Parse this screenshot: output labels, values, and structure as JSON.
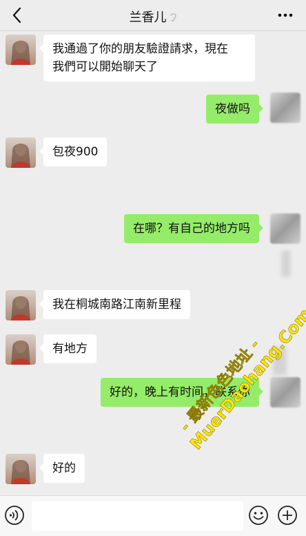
{
  "header": {
    "title": "兰香儿",
    "back_icon": "chevron-left-icon",
    "more_icon": "more-dots-icon",
    "ear_icon": "ear-mode-icon"
  },
  "messages": [
    {
      "side": "left",
      "text_lines": [
        "我通過了你的朋友驗證請求，現在",
        "我們可以開始聊天了"
      ]
    },
    {
      "side": "right",
      "text": "夜做吗"
    },
    {
      "side": "left",
      "text": "包夜900"
    },
    {
      "side": "right",
      "text": "在哪？有自己的地方吗"
    },
    {
      "side": "left",
      "text": "我在桐城南路江南新里程"
    },
    {
      "side": "left",
      "text": "有地方"
    },
    {
      "side": "right",
      "text": "好的，晚上有时间，联系你"
    },
    {
      "side": "left",
      "text": "好的"
    }
  ],
  "input_bar": {
    "voice_icon": "voice-icon",
    "emoji_icon": "emoji-icon",
    "plus_icon": "plus-icon",
    "input_value": ""
  },
  "watermark": {
    "line1": "- 最新色色地址 -",
    "line2": "MuerDaohang.Com"
  },
  "colors": {
    "background": "#ededed",
    "outgoing_bubble": "#95ec69",
    "incoming_bubble": "#ffffff",
    "watermark": "#ffe600"
  }
}
